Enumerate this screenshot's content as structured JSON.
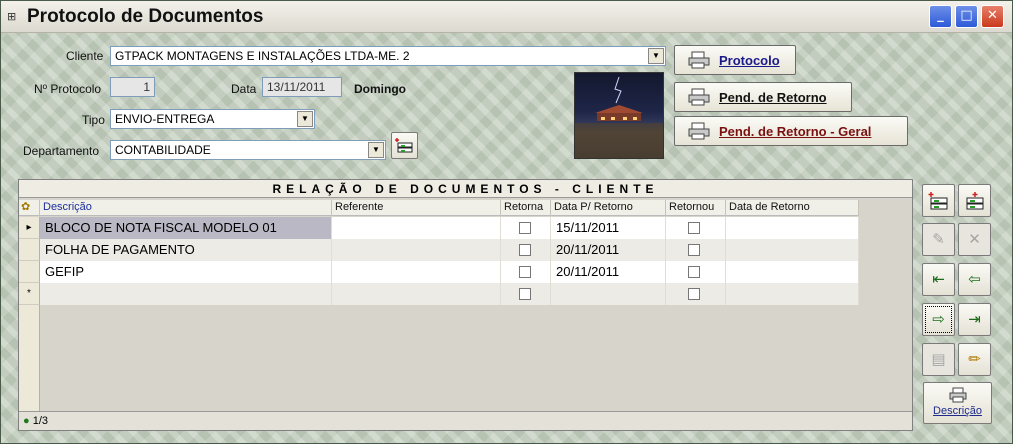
{
  "window": {
    "title": "Protocolo de Documentos",
    "minimize": "_",
    "maximize": "□",
    "close": "✕"
  },
  "form": {
    "cliente_label": "Cliente",
    "cliente_value": "GTPACK MONTAGENS E INSTALAÇÕES LTDA-ME.   2",
    "protocolo_label": "Nº Protocolo",
    "protocolo_value": "1",
    "data_label": "Data",
    "data_value": "13/11/2011",
    "weekday": "Domingo",
    "tipo_label": "Tipo",
    "tipo_value": "ENVIO-ENTREGA",
    "departamento_label": "Departamento",
    "departamento_value": "CONTABILIDADE"
  },
  "actions": {
    "protocolo": "Protocolo",
    "pend_retorno": "Pend. de Retorno",
    "pend_retorno_geral": "Pend. de Retorno - Geral"
  },
  "grid": {
    "title": "RELAÇÃO DE DOCUMENTOS - CLIENTE",
    "columns": [
      "Descrição",
      "Referente",
      "Retorna",
      "Data P/ Retorno",
      "Retornou",
      "Data de Retorno"
    ],
    "rows": [
      {
        "descricao": "BLOCO DE NOTA FISCAL MODELO 01",
        "referente": "",
        "retorna": false,
        "data_p_retorno": "15/11/2011",
        "retornou": false,
        "data_retorno": ""
      },
      {
        "descricao": "FOLHA DE PAGAMENTO",
        "referente": "",
        "retorna": false,
        "data_p_retorno": "20/11/2011",
        "retornou": false,
        "data_retorno": ""
      },
      {
        "descricao": "GEFIP",
        "referente": "",
        "retorna": false,
        "data_p_retorno": "20/11/2011",
        "retornou": false,
        "data_retorno": ""
      }
    ],
    "new_row_marker": "*",
    "current_row_marker": "▸",
    "status": "1/3"
  },
  "toolbar": {
    "descricao_label": "Descrição"
  },
  "icons": {
    "app": "app-icon",
    "printer": "printer-icon",
    "add_record": "add-record-icon"
  }
}
